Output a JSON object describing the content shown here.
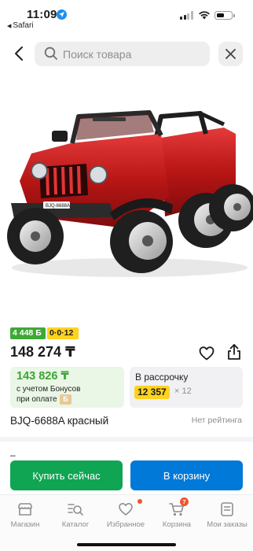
{
  "status_bar": {
    "time": "11:09",
    "back_app": "Safari"
  },
  "search": {
    "placeholder": "Поиск товара"
  },
  "icons": {
    "back": "chevron-left-icon",
    "search": "search-icon",
    "close": "close-icon",
    "favorite": "heart-icon",
    "share": "share-icon"
  },
  "product": {
    "image_alt": "Детский электромобиль красного цвета",
    "plate": "BJQ-6688A",
    "bonus_badge": "4 448 Б",
    "installment_badge": "0·0·12",
    "price": "148 274 ₸",
    "name": "BJQ-6688A красный",
    "rating": "Нет рейтинга",
    "bonus_card": {
      "price": "143 826 ₸",
      "line1": "с учетом Бонусов",
      "line2": "при оплате",
      "coin": "Б"
    },
    "installment_card": {
      "label": "В рассрочку",
      "amount": "12 357",
      "months": "× 12"
    },
    "dash": "–"
  },
  "actions": {
    "buy_now": "Купить сейчас",
    "add_to_cart": "В корзину"
  },
  "tabs": [
    {
      "label": "Магазин",
      "icon": "store-icon"
    },
    {
      "label": "Каталог",
      "icon": "catalog-icon"
    },
    {
      "label": "Избранное",
      "icon": "heart-icon"
    },
    {
      "label": "Корзина",
      "icon": "cart-icon",
      "badge": "7"
    },
    {
      "label": "Мои заказы",
      "icon": "orders-icon"
    }
  ],
  "colors": {
    "green": "#0fa552",
    "blue": "#0079d8",
    "yellow": "#ffd21f",
    "bonus_green": "#3fa935",
    "badge_red": "#f0552e"
  }
}
